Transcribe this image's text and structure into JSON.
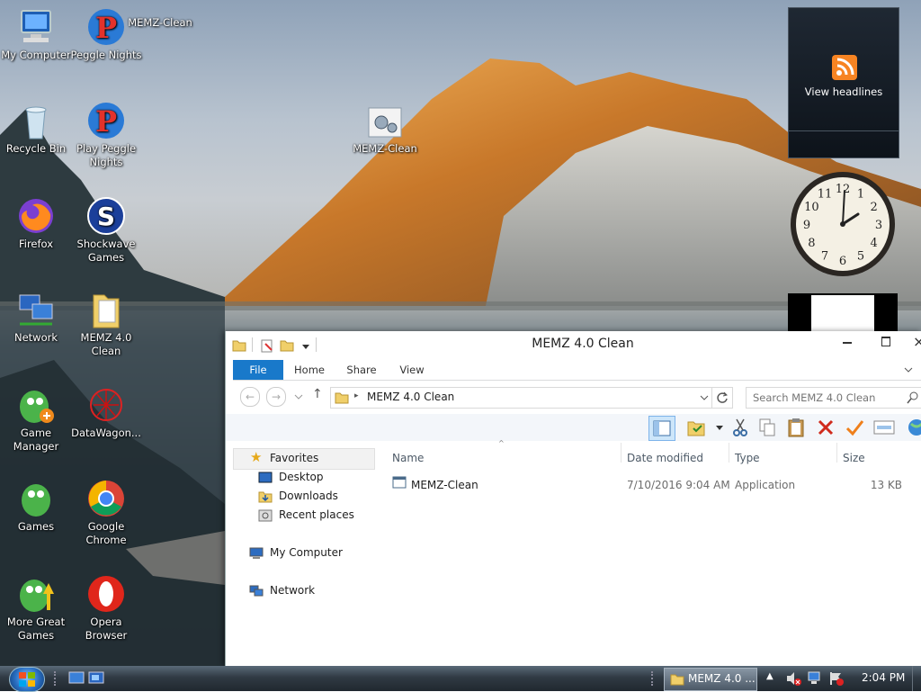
{
  "desktop_icons": [
    {
      "label": "My Computer",
      "icon": "computer-icon"
    },
    {
      "label": "Peggle Nights",
      "icon": "peggle-icon"
    },
    {
      "label": "MEMZ-Clean",
      "icon": "memz-gear-icon"
    },
    {
      "label": "Recycle Bin",
      "icon": "recycle-bin-icon"
    },
    {
      "label": "Play Peggle Nights",
      "icon": "peggle-icon"
    },
    {
      "label": "MEMZ-Clean",
      "icon": "memz-gear-icon"
    },
    {
      "label": "Firefox",
      "icon": "firefox-icon"
    },
    {
      "label": "Shockwave Games",
      "icon": "shockwave-icon"
    },
    {
      "label": "Network",
      "icon": "network-icon"
    },
    {
      "label": "MEMZ 4.0 Clean",
      "icon": "folder-icon"
    },
    {
      "label": "Game Manager",
      "icon": "game-manager-icon"
    },
    {
      "label": "DataWagon...",
      "icon": "datawagon-icon"
    },
    {
      "label": "Games",
      "icon": "games-icon"
    },
    {
      "label": "Google Chrome",
      "icon": "chrome-icon"
    },
    {
      "label": "More Great Games",
      "icon": "more-games-icon"
    },
    {
      "label": "Opera Browser",
      "icon": "opera-icon"
    }
  ],
  "gadgets": {
    "feed": {
      "label": "View headlines",
      "icon": "rss-icon"
    },
    "clock": {
      "numerals": [
        "12",
        "1",
        "2",
        "3",
        "4",
        "5",
        "6",
        "7",
        "8",
        "9",
        "10",
        "11"
      ],
      "time_shown": "2:04"
    }
  },
  "explorer": {
    "title": "MEMZ 4.0 Clean",
    "ribbon_tabs": [
      "File",
      "Home",
      "Share",
      "View"
    ],
    "address": {
      "path": "MEMZ 4.0 Clean",
      "search_placeholder": "Search MEMZ 4.0 Clean"
    },
    "nav": {
      "favorites_label": "Favorites",
      "favorites": [
        "Desktop",
        "Downloads",
        "Recent places"
      ],
      "computer": "My Computer",
      "network": "Network"
    },
    "columns": [
      "Name",
      "Date modified",
      "Type",
      "Size"
    ],
    "files": [
      {
        "name": "MEMZ-Clean",
        "date_modified": "7/10/2016 9:04 AM",
        "type": "Application",
        "size": "13 KB"
      }
    ]
  },
  "taskbar": {
    "active_task": "MEMZ 4.0 ...",
    "clock": "2:04 PM"
  },
  "colors": {
    "file_tab": "#1979ca",
    "taskbar": "#2a333b",
    "selection": "#cce8ff"
  }
}
